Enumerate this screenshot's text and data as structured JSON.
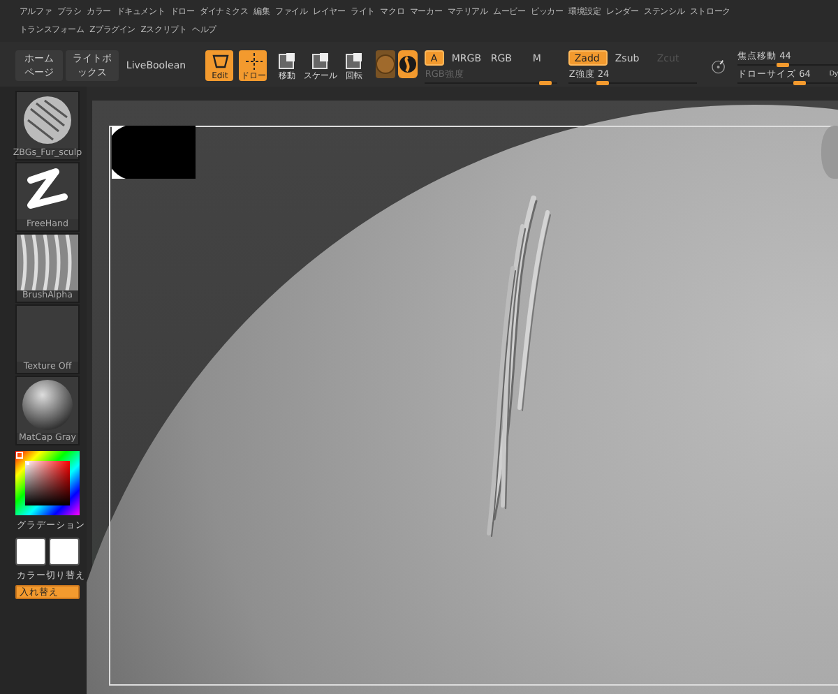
{
  "menu_rows": [
    [
      "アルファ",
      "ブラシ",
      "カラー",
      "ドキュメント",
      "ドロー",
      "ダイナミクス",
      "編集",
      "ファイル",
      "レイヤー",
      "ライト",
      "マクロ",
      "マーカー",
      "マテリアル",
      "ムービー",
      "ピッカー",
      "環境設定",
      "レンダー",
      "ステンシル",
      "ストローク"
    ],
    [
      "トランスフォーム",
      "Zプラグイン",
      "Zスクリプト",
      "ヘルプ"
    ]
  ],
  "toolbar": {
    "left_buttons": [
      "ホームページ",
      "ライトボックス",
      "LiveBoolean"
    ],
    "tools": [
      {
        "kind": "edit",
        "label": "Edit",
        "selected": true
      },
      {
        "kind": "draw",
        "label": "ドロー",
        "selected": true
      },
      {
        "kind": "move",
        "label": "移動",
        "selected": false
      },
      {
        "kind": "scale",
        "label": "スケール",
        "selected": false
      },
      {
        "kind": "rotate",
        "label": "回転",
        "selected": false
      }
    ],
    "rgb_buttons": [
      {
        "label": "A",
        "selected": true
      },
      {
        "label": "MRGB",
        "selected": false
      },
      {
        "label": "RGB",
        "selected": false
      },
      {
        "label": "M",
        "selected": false
      }
    ],
    "rgb_intensity": {
      "label": "RGB強度",
      "level": 0.95,
      "disabled": true
    },
    "z_buttons": [
      {
        "label": "Zadd",
        "selected": true,
        "disabled": false
      },
      {
        "label": "Zsub",
        "selected": false,
        "disabled": false
      },
      {
        "label": "Zcut",
        "selected": false,
        "disabled": true
      }
    ],
    "z_intensity": {
      "label": "Z強度 24",
      "level": 0.24
    },
    "progress": {
      "level": 0.5
    },
    "focal_shift": {
      "label": "焦点移動 44",
      "level": 0.44
    },
    "draw_size": {
      "label": "ドローサイズ 64",
      "level": 0.64
    },
    "dynamic_button": "Dy"
  },
  "shelf": {
    "thumbs": [
      {
        "kind": "brush",
        "label": "ZBGs_Fur_sculp"
      },
      {
        "kind": "stroke",
        "label": "FreeHand"
      },
      {
        "kind": "alpha",
        "label": "BrushAlpha"
      },
      {
        "kind": "texture",
        "label": "Texture Off"
      },
      {
        "kind": "material",
        "label": "MatCap Gray"
      }
    ],
    "gradient_label": "グラデーション",
    "swap_label": "カラー切り替え",
    "swap_button": "入れ替え"
  }
}
